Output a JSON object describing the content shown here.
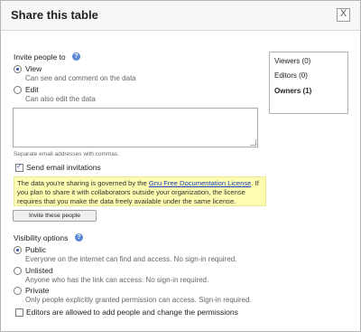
{
  "dialog": {
    "title": "Share this table",
    "close_label": "X"
  },
  "invite": {
    "label": "Invite people to",
    "options": [
      {
        "title": "View",
        "description": "Can see and comment on the data",
        "selected": true
      },
      {
        "title": "Edit",
        "description": "Can also edit the data",
        "selected": false
      }
    ],
    "email_value": "",
    "hint": "Separate email addresses with commas.",
    "send_email_label": "Send email invitations",
    "send_email_checked": true,
    "notice_before_link": "The data you're sharing is governed by the ",
    "notice_link": "Gnu Free Documentation License",
    "notice_after_link": ". If you plan to share it with collaborators outside your organization, the license requires that you make the data freely available under the same license.",
    "invite_button": "Invite these people"
  },
  "visibility": {
    "label": "Visibility options",
    "options": [
      {
        "title": "Public",
        "description": "Everyone on the internet can find and access. No sign-in required.",
        "selected": true
      },
      {
        "title": "Unlisted",
        "description": "Anyone who has the link can access. No sign-in required.",
        "selected": false
      },
      {
        "title": "Private",
        "description": "Only people explicitly granted permission can access. Sign-in required.",
        "selected": false
      }
    ],
    "editors_label": "Editors are allowed to add people and change the permissions",
    "editors_checked": false
  },
  "sidebar": {
    "items": [
      {
        "label": "Viewers (0)"
      },
      {
        "label": "Editors (0)"
      },
      {
        "label": "Owners (1)"
      }
    ]
  },
  "colors": {
    "notice_bg": "#fdfcb0",
    "link": "#1a3fc4",
    "accent": "#2a4fa6"
  }
}
